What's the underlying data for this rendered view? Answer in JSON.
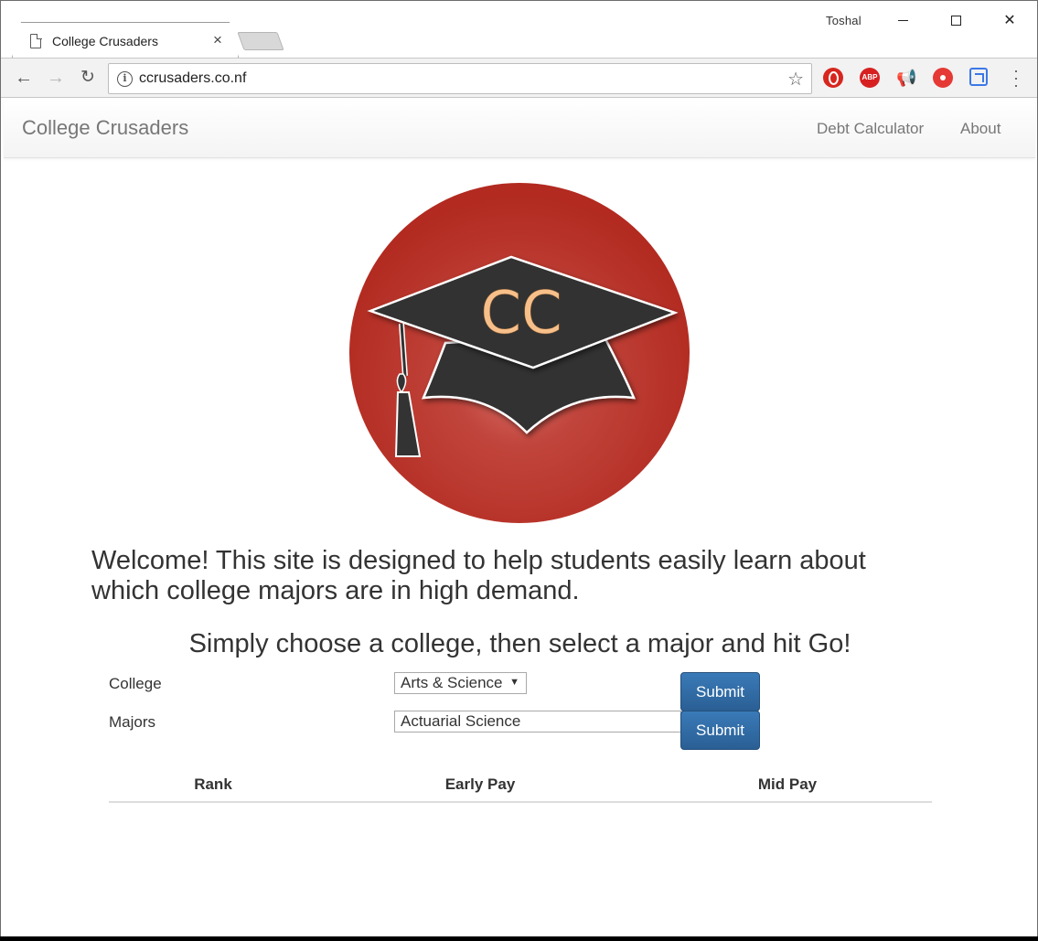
{
  "browser": {
    "tab_title": "College Crusaders",
    "tab_close": "×",
    "user_name": "Toshal",
    "url": "ccrusaders.co.nf",
    "extensions": [
      "opera-block-icon",
      "adblock-plus-icon",
      "megaphone-icon",
      "record-icon",
      "cast-icon"
    ],
    "abp_label": "ABP"
  },
  "navbar": {
    "brand": "College Crusaders",
    "links": [
      "Debt Calculator",
      "About"
    ]
  },
  "logo": {
    "text": "CC",
    "colors": {
      "circle": "#b52a1f",
      "cap": "#333333",
      "text": "#f7c08a"
    }
  },
  "welcome_text": "Welcome! This site is designed to help students easily learn about which college majors are in high demand.",
  "instructions": "Simply choose a college, then select a major and hit Go!",
  "form": {
    "college_label": "College",
    "college_value": "Arts & Science",
    "majors_label": "Majors",
    "majors_value": "Actuarial Science",
    "submit_label": "Submit"
  },
  "table": {
    "headers": [
      "Rank",
      "Early Pay",
      "Mid Pay"
    ]
  },
  "colors": {
    "button": "#2e6da4",
    "text": "#333333",
    "nav_text": "#777777"
  }
}
